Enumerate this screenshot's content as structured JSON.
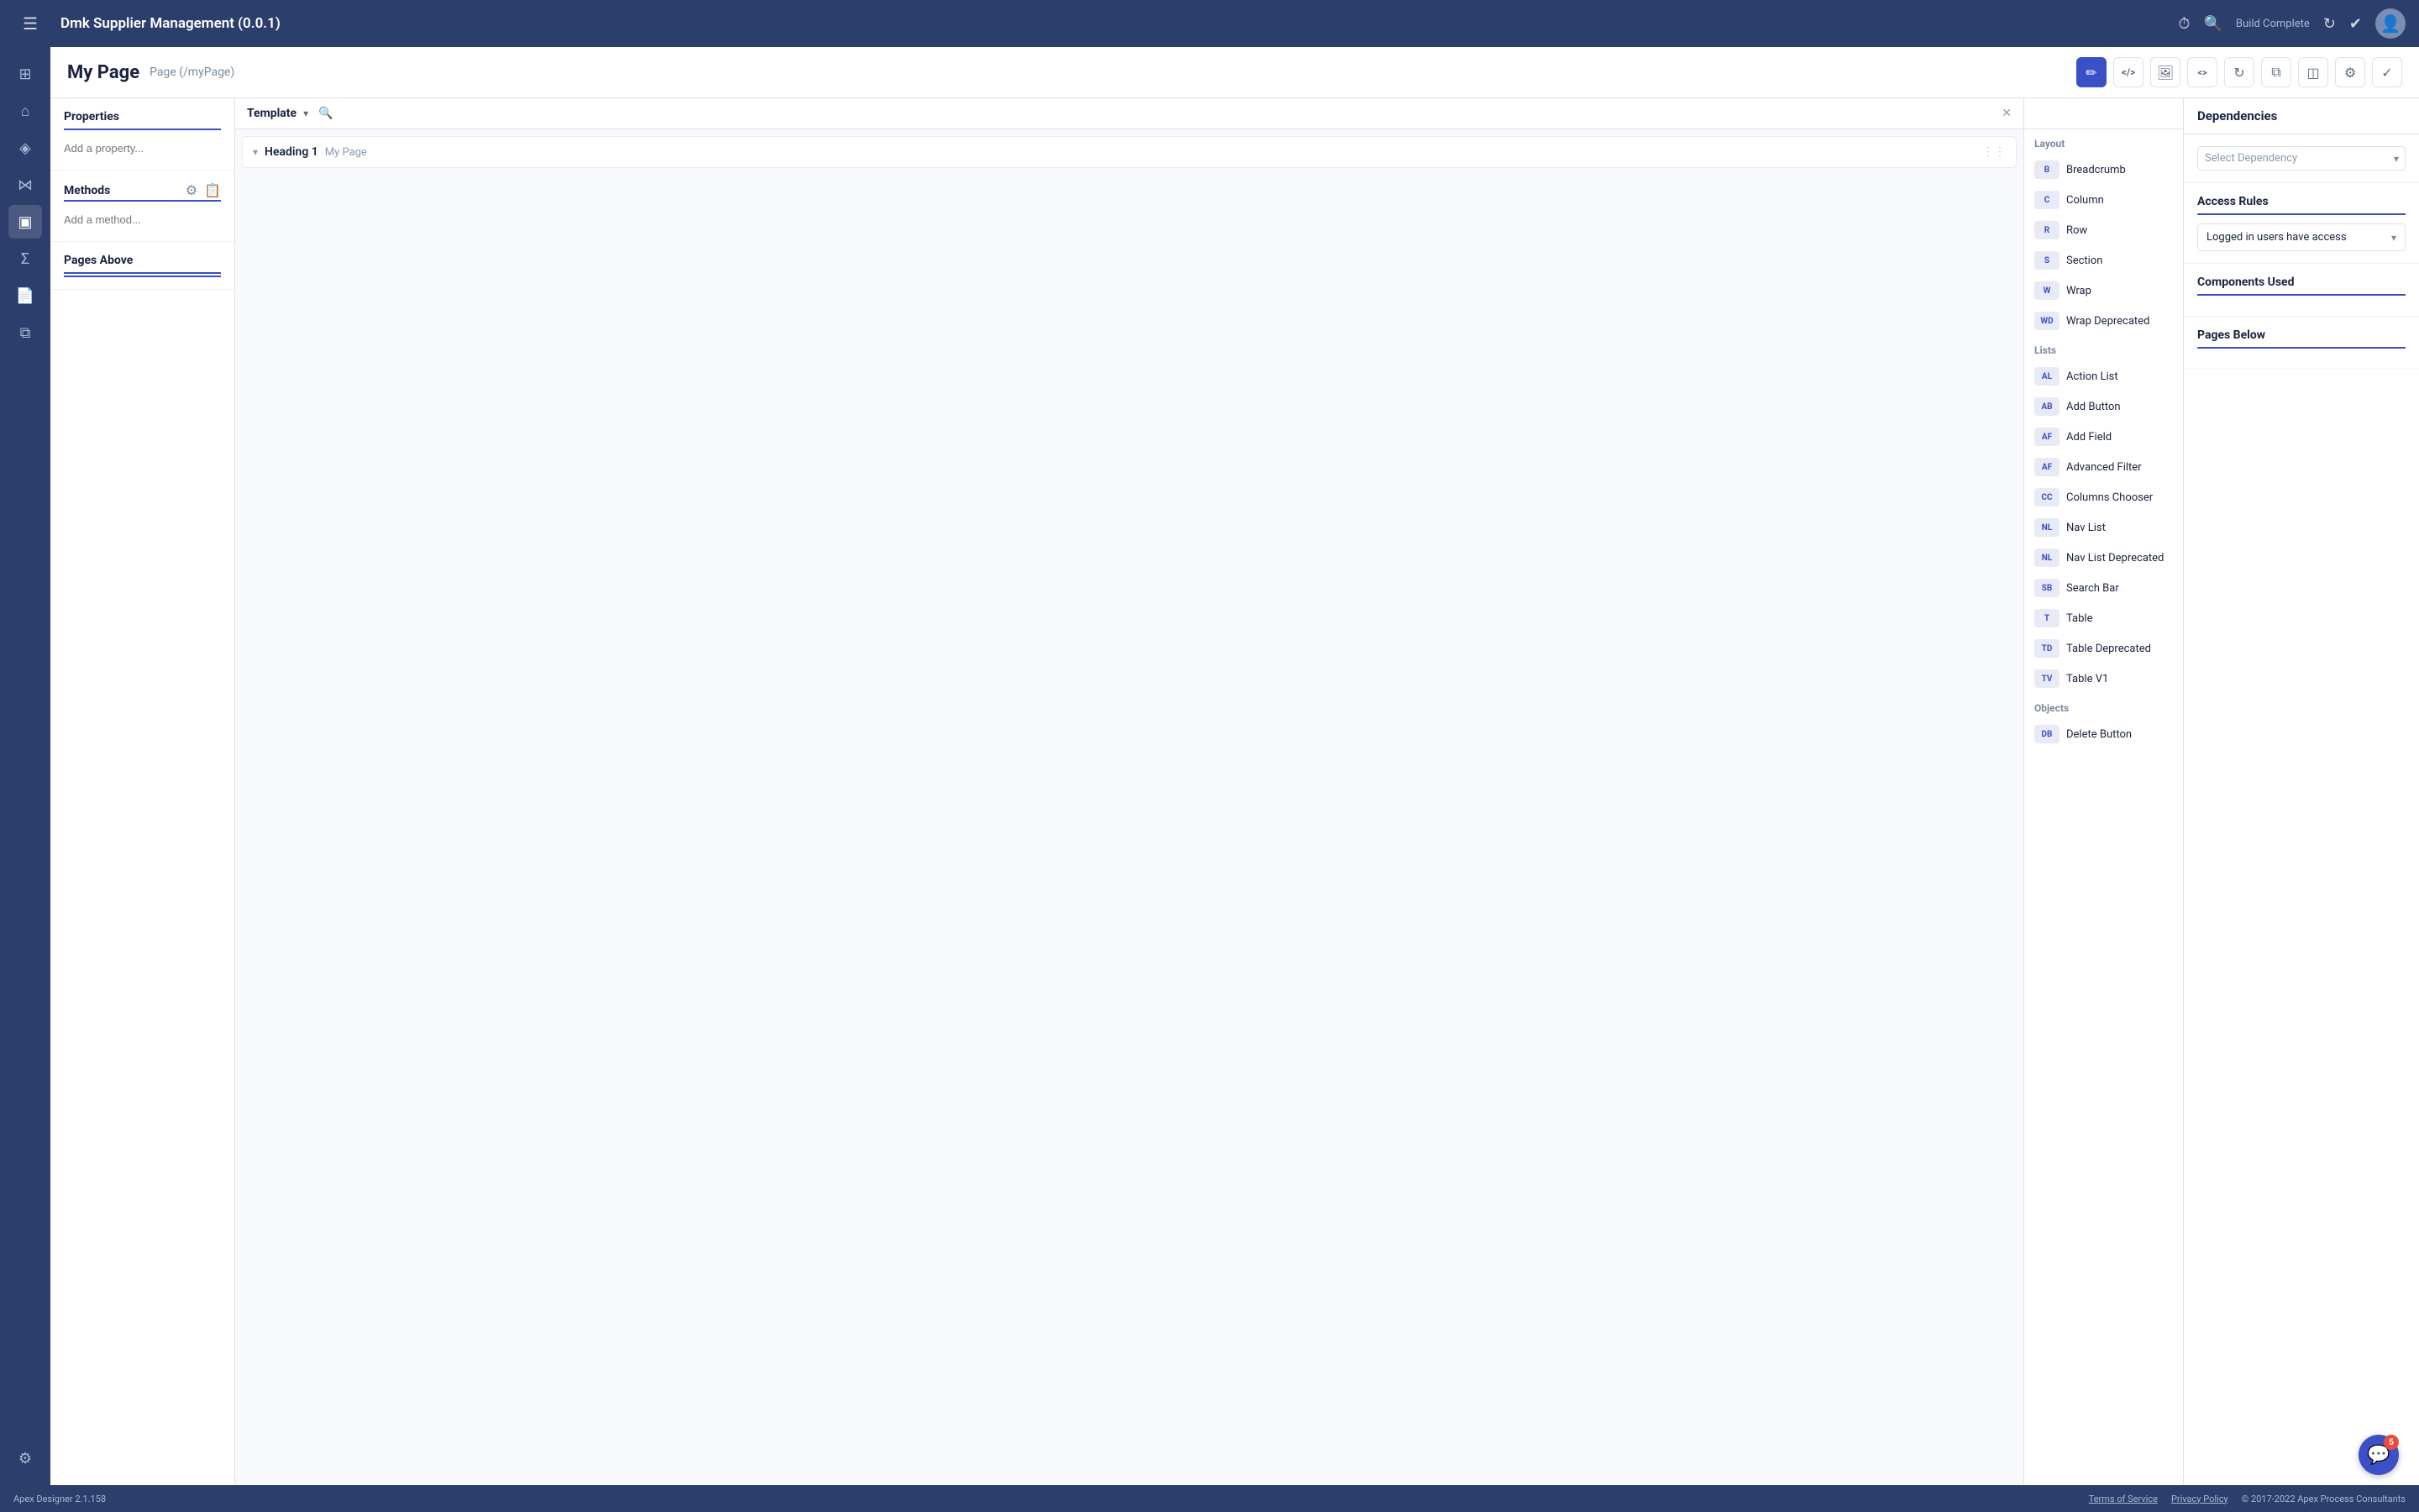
{
  "app": {
    "title": "Dmk Supplier Management (0.0.1)",
    "build_status": "Build Complete",
    "version": "Apex Designer 2.1.158"
  },
  "page": {
    "title": "My Page",
    "path": "Page (/myPage)"
  },
  "sidebar": {
    "items": [
      {
        "id": "grid",
        "icon": "⊞",
        "label": "grid-icon"
      },
      {
        "id": "home",
        "icon": "⌂",
        "label": "home-icon"
      },
      {
        "id": "dashboard",
        "icon": "◈",
        "label": "dashboard-icon"
      },
      {
        "id": "share",
        "icon": "⋈",
        "label": "share-icon"
      },
      {
        "id": "layout",
        "icon": "▣",
        "label": "layout-icon"
      },
      {
        "id": "sigma",
        "icon": "Σ",
        "label": "sigma-icon"
      },
      {
        "id": "document",
        "icon": "📄",
        "label": "document-icon"
      },
      {
        "id": "puzzle",
        "icon": "⧉",
        "label": "puzzle-icon"
      },
      {
        "id": "settings",
        "icon": "⚙",
        "label": "settings-icon"
      }
    ]
  },
  "header_buttons": [
    {
      "id": "edit",
      "icon": "✏",
      "active": true
    },
    {
      "id": "code-view",
      "icon": "</>",
      "active": false
    },
    {
      "id": "image",
      "icon": "🖼",
      "active": false
    },
    {
      "id": "embed",
      "icon": "<>",
      "active": false
    },
    {
      "id": "refresh",
      "icon": "↻",
      "active": false
    },
    {
      "id": "copy",
      "icon": "⧉",
      "active": false
    },
    {
      "id": "layers",
      "icon": "◫",
      "active": false
    },
    {
      "id": "gear",
      "icon": "⚙",
      "active": false
    },
    {
      "id": "check",
      "icon": "✓",
      "active": false
    }
  ],
  "properties": {
    "section_title": "Properties",
    "placeholder": "Add a property..."
  },
  "methods": {
    "section_title": "Methods",
    "placeholder": "Add a method..."
  },
  "pages_above": {
    "section_title": "Pages Above"
  },
  "template": {
    "label": "Template",
    "search_placeholder": "",
    "rows": [
      {
        "arrow": "▾",
        "heading": "Heading 1",
        "sub": "My Page",
        "grip": "⋮⋮"
      }
    ]
  },
  "components": {
    "search_placeholder": "",
    "sections": {
      "layout": {
        "label": "Layout",
        "items": [
          {
            "badge": "B",
            "label": "Breadcrumb"
          },
          {
            "badge": "C",
            "label": "Column"
          },
          {
            "badge": "R",
            "label": "Row"
          },
          {
            "badge": "S",
            "label": "Section"
          },
          {
            "badge": "W",
            "label": "Wrap"
          },
          {
            "badge": "WD",
            "label": "Wrap Deprecated"
          }
        ]
      },
      "lists": {
        "label": "Lists",
        "items": [
          {
            "badge": "AL",
            "label": "Action List"
          },
          {
            "badge": "AB",
            "label": "Add Button"
          },
          {
            "badge": "AF",
            "label": "Add Field"
          },
          {
            "badge": "AF",
            "label": "Advanced Filter"
          },
          {
            "badge": "CC",
            "label": "Columns Chooser"
          },
          {
            "badge": "NL",
            "label": "Nav List"
          },
          {
            "badge": "NL",
            "label": "Nav List Deprecated"
          },
          {
            "badge": "SB",
            "label": "Search Bar"
          },
          {
            "badge": "T",
            "label": "Table"
          },
          {
            "badge": "TD",
            "label": "Table Deprecated"
          },
          {
            "badge": "TV",
            "label": "Table V1"
          }
        ]
      },
      "objects": {
        "label": "Objects",
        "items": [
          {
            "badge": "DB",
            "label": "Delete Button"
          }
        ]
      }
    }
  },
  "dependencies": {
    "section_title": "Dependencies",
    "select_placeholder": "Select Dependency",
    "access_rules": {
      "section_title": "Access Rules",
      "value": "Logged in users have access"
    },
    "components_used": {
      "section_title": "Components Used"
    },
    "pages_below": {
      "section_title": "Pages Below"
    }
  },
  "footer": {
    "left": "Apex Designer 2.1.158",
    "links": [
      "Terms of Service",
      "Privacy Policy",
      "© 2017-2022 Apex Process Consultants"
    ]
  },
  "chat": {
    "badge": "5"
  }
}
